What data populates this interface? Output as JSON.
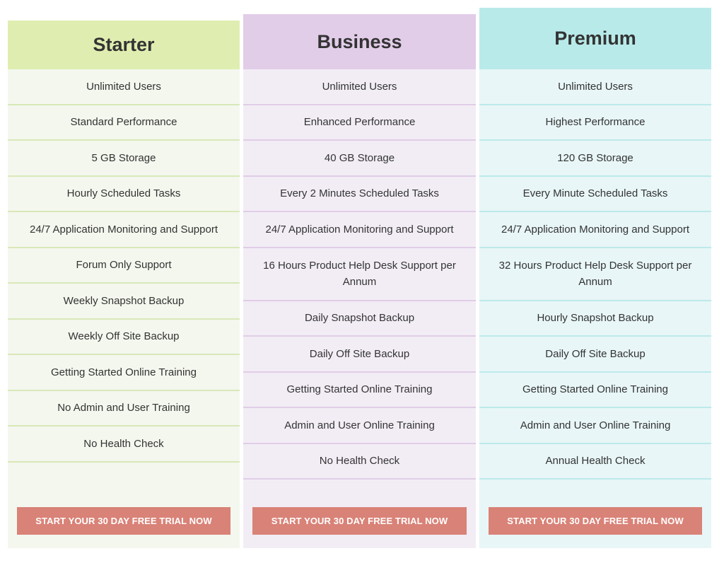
{
  "plans": [
    {
      "name": "Starter",
      "features": [
        "Unlimited Users",
        "Standard Performance",
        "5 GB Storage",
        "Hourly Scheduled Tasks",
        "24/7 Application Monitoring and Support",
        "Forum Only Support",
        "Weekly Snapshot Backup",
        "Weekly Off Site Backup",
        "Getting Started Online Training",
        "No Admin and User Training",
        "No Health Check"
      ],
      "cta": "START YOUR 30 DAY FREE TRIAL NOW"
    },
    {
      "name": "Business",
      "features": [
        "Unlimited Users",
        "Enhanced Performance",
        "40 GB Storage",
        "Every 2 Minutes Scheduled Tasks",
        "24/7 Application Monitoring and Support",
        "16 Hours Product Help Desk Support per Annum",
        "Daily Snapshot Backup",
        "Daily Off Site Backup",
        "Getting Started Online Training",
        "Admin and User Online Training",
        "No Health Check"
      ],
      "cta": "START YOUR 30 DAY FREE TRIAL NOW"
    },
    {
      "name": "Premium",
      "features": [
        "Unlimited Users",
        "Highest Performance",
        "120 GB Storage",
        "Every Minute Scheduled Tasks",
        "24/7 Application Monitoring and Support",
        "32 Hours Product Help Desk Support per Annum",
        "Hourly Snapshot Backup",
        "Daily Off Site Backup",
        "Getting Started Online Training",
        "Admin and User Online Training",
        "Annual Health Check"
      ],
      "cta": "START YOUR 30 DAY FREE TRIAL NOW"
    }
  ],
  "colors": {
    "starter_header": "#dfeeb0",
    "business_header": "#e2cde9",
    "premium_header": "#b9eaea",
    "button": "#d98277"
  }
}
